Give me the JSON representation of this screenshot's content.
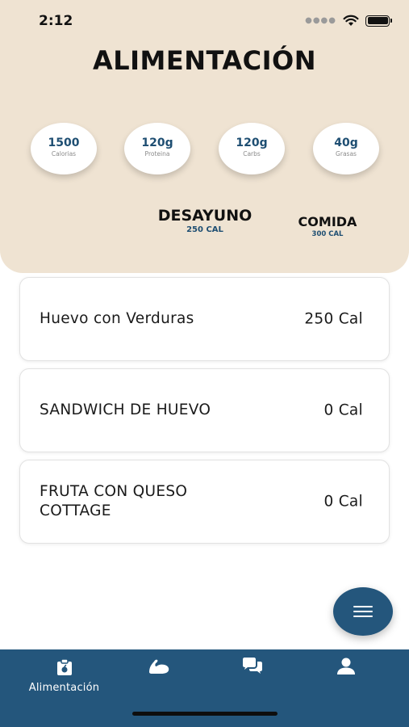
{
  "status_bar": {
    "time": "2:12"
  },
  "header": {
    "title": "ALIMENTACIÓN",
    "macros": [
      {
        "value": "1500",
        "label": "Calorias"
      },
      {
        "value": "120g",
        "label": "Proteina"
      },
      {
        "value": "120g",
        "label": "Carbs"
      },
      {
        "value": "40g",
        "label": "Grasas"
      }
    ],
    "meal_tabs": [
      {
        "name": "DESAYUNO",
        "calories": "250 CAL",
        "selected": true
      },
      {
        "name": "COMIDA",
        "calories": "300 CAL",
        "selected": false
      }
    ]
  },
  "foods": [
    {
      "name": "Huevo con Verduras",
      "calories": "250 Cal"
    },
    {
      "name": "SANDWICH DE HUEVO",
      "calories": "0 Cal"
    },
    {
      "name": "FRUTA CON QUESO COTTAGE",
      "calories": "0 Cal"
    }
  ],
  "fab": {
    "icon": "menu-icon"
  },
  "bottom_nav": {
    "items": [
      {
        "icon": "nutrition-icon",
        "label": "Alimentación",
        "active": true
      },
      {
        "icon": "muscle-arm-icon",
        "label": ""
      },
      {
        "icon": "chat-icon",
        "label": ""
      },
      {
        "icon": "profile-icon",
        "label": ""
      }
    ]
  },
  "colors": {
    "header_bg": "#efe3d2",
    "accent": "#24567c",
    "macro_value": "#1e4e72"
  }
}
